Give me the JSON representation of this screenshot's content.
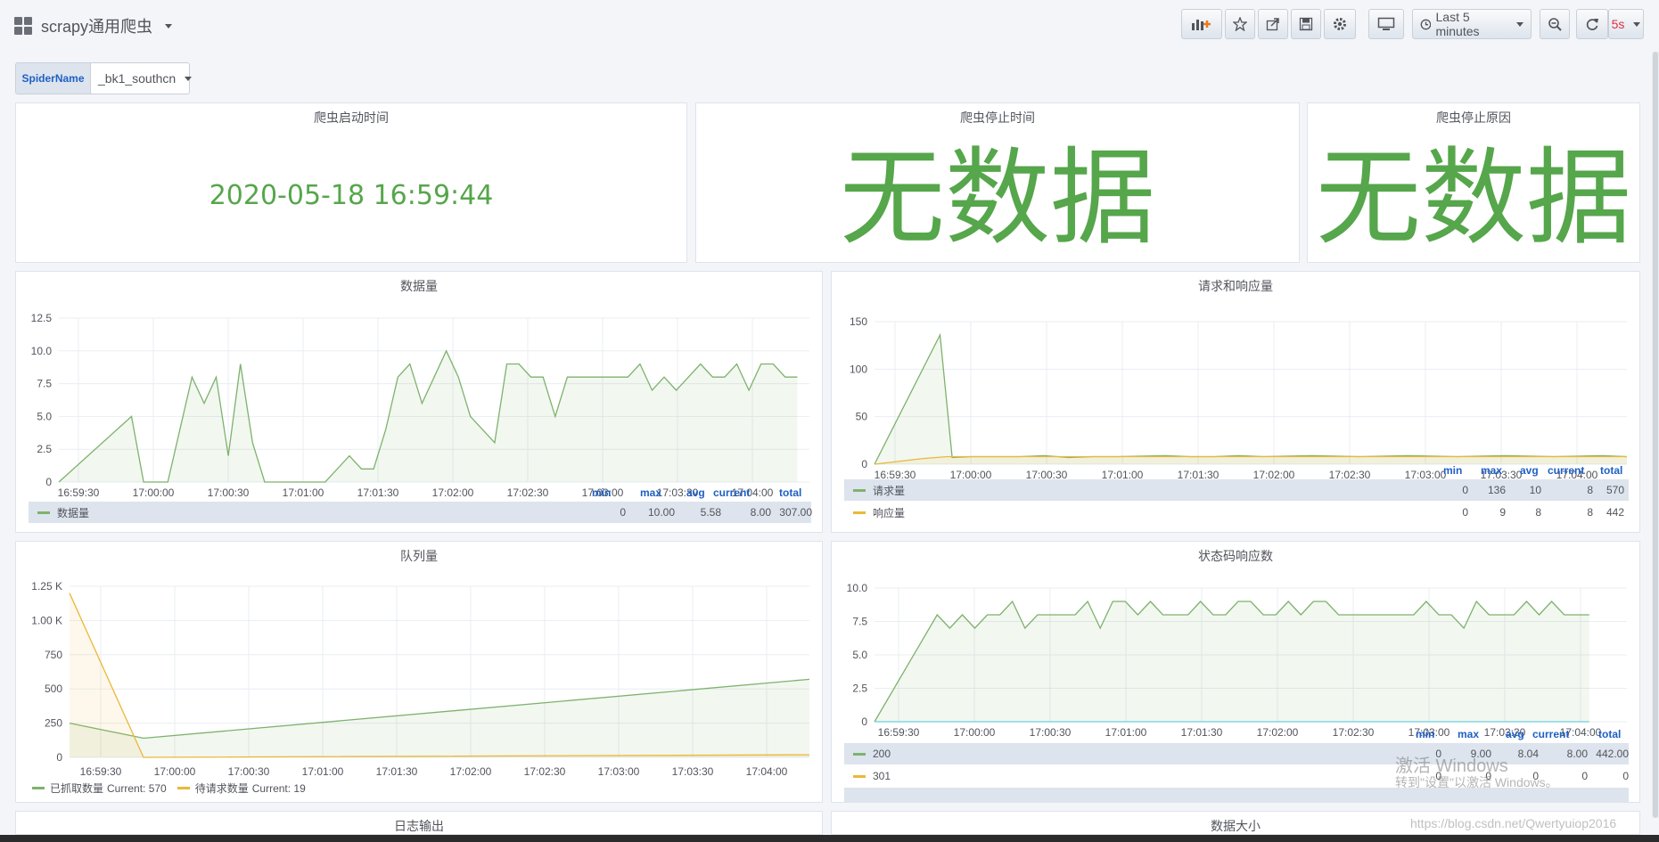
{
  "header": {
    "dashboard_title": "scrapy通用爬虫",
    "time_range": "Last 5 minutes",
    "refresh_interval": "5s"
  },
  "variables": {
    "label": "SpiderName",
    "value": "_bk1_southcn"
  },
  "panels": {
    "start_time": {
      "title": "爬虫启动时间",
      "value": "2020-05-18 16:59:44"
    },
    "stop_time": {
      "title": "爬虫停止时间",
      "value": "无数据"
    },
    "stop_reason": {
      "title": "爬虫停止原因",
      "value": "无数据"
    },
    "data_volume": {
      "title": "数据量"
    },
    "req_resp": {
      "title": "请求和响应量"
    },
    "queue": {
      "title": "队列量"
    },
    "status_code": {
      "title": "状态码响应数"
    },
    "log_output": {
      "title": "日志输出"
    },
    "data_size": {
      "title": "数据大小"
    }
  },
  "legend_headers": {
    "min": "min",
    "max": "max",
    "avg": "avg",
    "current": "current",
    "total": "total"
  },
  "colors": {
    "green": "#7eb26d",
    "yellow": "#eab839",
    "blue": "#6ed0e0",
    "stat_green": "#56a64b"
  },
  "chart_data": [
    {
      "type": "area",
      "title": "数据量",
      "x_ticks": [
        "16:59:30",
        "17:00:00",
        "17:00:30",
        "17:01:00",
        "17:01:30",
        "17:02:00",
        "17:02:30",
        "17:03:00",
        "17:03:30",
        "17:04:00"
      ],
      "y_ticks": [
        "0",
        "2.5",
        "5.0",
        "7.5",
        "10.0",
        "12.5"
      ],
      "ylim": [
        0,
        12.5
      ],
      "series": [
        {
          "name": "数据量",
          "color": "#7eb26d",
          "points": [
            [
              0,
              0
            ],
            [
              30,
              5
            ],
            [
              35,
              0
            ],
            [
              45,
              0
            ],
            [
              55,
              8
            ],
            [
              60,
              6
            ],
            [
              65,
              8
            ],
            [
              70,
              2
            ],
            [
              75,
              9
            ],
            [
              80,
              3
            ],
            [
              85,
              0
            ],
            [
              110,
              0
            ],
            [
              120,
              2
            ],
            [
              125,
              1
            ],
            [
              130,
              1
            ],
            [
              135,
              4
            ],
            [
              140,
              8
            ],
            [
              145,
              9
            ],
            [
              150,
              6
            ],
            [
              160,
              10
            ],
            [
              165,
              8
            ],
            [
              170,
              5
            ],
            [
              180,
              3
            ],
            [
              185,
              9
            ],
            [
              190,
              9
            ],
            [
              195,
              8
            ],
            [
              200,
              8
            ],
            [
              205,
              5
            ],
            [
              210,
              8
            ],
            [
              225,
              8
            ],
            [
              230,
              8
            ],
            [
              235,
              8
            ],
            [
              240,
              9
            ],
            [
              245,
              7
            ],
            [
              250,
              8
            ],
            [
              255,
              7
            ],
            [
              265,
              9
            ],
            [
              270,
              8
            ],
            [
              275,
              8
            ],
            [
              280,
              9
            ],
            [
              285,
              7
            ],
            [
              290,
              9
            ],
            [
              295,
              9
            ],
            [
              300,
              8
            ],
            [
              305,
              8
            ]
          ],
          "min": "0",
          "max": "10.00",
          "avg": "5.58",
          "current": "8.00",
          "total": "307.00"
        }
      ]
    },
    {
      "type": "area",
      "title": "请求和响应量",
      "x_ticks": [
        "16:59:30",
        "17:00:00",
        "17:00:30",
        "17:01:00",
        "17:01:30",
        "17:02:00",
        "17:02:30",
        "17:03:00",
        "17:03:30",
        "17:04:00"
      ],
      "y_ticks": [
        "0",
        "50",
        "100",
        "150"
      ],
      "ylim": [
        0,
        150
      ],
      "series": [
        {
          "name": "请求量",
          "color": "#7eb26d",
          "points": [
            [
              0,
              0
            ],
            [
              27,
              136
            ],
            [
              32,
              7
            ],
            [
              40,
              8
            ],
            [
              60,
              8
            ],
            [
              70,
              9
            ],
            [
              80,
              7
            ],
            [
              90,
              8
            ],
            [
              100,
              8
            ],
            [
              120,
              9
            ],
            [
              130,
              8
            ],
            [
              140,
              8
            ],
            [
              150,
              9
            ],
            [
              160,
              8
            ],
            [
              180,
              9
            ],
            [
              200,
              8
            ],
            [
              220,
              9
            ],
            [
              240,
              8
            ],
            [
              260,
              9
            ],
            [
              280,
              8
            ],
            [
              300,
              9
            ],
            [
              310,
              8
            ]
          ],
          "min": "0",
          "max": "136",
          "avg": "10",
          "current": "8",
          "total": "570"
        },
        {
          "name": "响应量",
          "color": "#eab839",
          "points": [
            [
              0,
              0
            ],
            [
              20,
              6
            ],
            [
              30,
              8
            ],
            [
              60,
              8
            ],
            [
              100,
              8
            ],
            [
              150,
              8
            ],
            [
              200,
              8
            ],
            [
              250,
              8
            ],
            [
              300,
              8
            ],
            [
              310,
              8
            ]
          ],
          "min": "0",
          "max": "9",
          "avg": "8",
          "current": "8",
          "total": "442"
        }
      ]
    },
    {
      "type": "area",
      "title": "队列量",
      "x_ticks": [
        "16:59:30",
        "17:00:00",
        "17:00:30",
        "17:01:00",
        "17:01:30",
        "17:02:00",
        "17:02:30",
        "17:03:00",
        "17:03:30",
        "17:04:00"
      ],
      "y_ticks": [
        "0",
        "250",
        "500",
        "750",
        "1.00 K",
        "1.25 K"
      ],
      "ylim": [
        0,
        1250
      ],
      "series": [
        {
          "name": "已抓取数量",
          "color": "#7eb26d",
          "points": [
            [
              0,
              250
            ],
            [
              30,
              140
            ],
            [
              300,
              570
            ]
          ],
          "legend_text": "Current: 570"
        },
        {
          "name": "待请求数量",
          "color": "#eab839",
          "points": [
            [
              0,
              1200
            ],
            [
              30,
              0
            ],
            [
              300,
              19
            ]
          ],
          "legend_text": "Current: 19"
        }
      ]
    },
    {
      "type": "area",
      "title": "状态码响应数",
      "x_ticks": [
        "16:59:30",
        "17:00:00",
        "17:00:30",
        "17:01:00",
        "17:01:30",
        "17:02:00",
        "17:02:30",
        "17:03:00",
        "17:03:30",
        "17:04:00"
      ],
      "y_ticks": [
        "0",
        "2.5",
        "5.0",
        "7.5",
        "10.0"
      ],
      "ylim": [
        0,
        10
      ],
      "series": [
        {
          "name": "200",
          "color": "#7eb26d",
          "points": [
            [
              0,
              0
            ],
            [
              25,
              8
            ],
            [
              30,
              7
            ],
            [
              35,
              8
            ],
            [
              40,
              7
            ],
            [
              45,
              8
            ],
            [
              50,
              8
            ],
            [
              55,
              9
            ],
            [
              60,
              7
            ],
            [
              65,
              8
            ],
            [
              80,
              8
            ],
            [
              85,
              9
            ],
            [
              90,
              7
            ],
            [
              95,
              9
            ],
            [
              100,
              9
            ],
            [
              105,
              8
            ],
            [
              110,
              9
            ],
            [
              115,
              8
            ],
            [
              125,
              8
            ],
            [
              130,
              9
            ],
            [
              135,
              8
            ],
            [
              140,
              8
            ],
            [
              145,
              9
            ],
            [
              150,
              9
            ],
            [
              155,
              8
            ],
            [
              160,
              8
            ],
            [
              165,
              9
            ],
            [
              170,
              8
            ],
            [
              175,
              9
            ],
            [
              180,
              9
            ],
            [
              185,
              8
            ],
            [
              215,
              8
            ],
            [
              220,
              9
            ],
            [
              225,
              8
            ],
            [
              230,
              8
            ],
            [
              235,
              7
            ],
            [
              240,
              9
            ],
            [
              245,
              8
            ],
            [
              255,
              8
            ],
            [
              260,
              9
            ],
            [
              265,
              8
            ],
            [
              270,
              9
            ],
            [
              275,
              8
            ],
            [
              285,
              8
            ]
          ],
          "min": "0",
          "max": "9.00",
          "avg": "8.04",
          "current": "8.00",
          "total": "442.00"
        },
        {
          "name": "301",
          "color": "#eab839",
          "points": [],
          "min": "0",
          "max": "0",
          "avg": "0",
          "current": "0",
          "total": "0"
        },
        {
          "name": "",
          "color": "#6ed0e0",
          "points": [
            [
              0,
              0
            ],
            [
              285,
              0
            ]
          ]
        }
      ]
    }
  ],
  "watermark": {
    "line1": "激活 Windows",
    "line2": "转到\"设置\"以激活 Windows。",
    "url": "https://blog.csdn.net/Qwertyuiop2016"
  }
}
